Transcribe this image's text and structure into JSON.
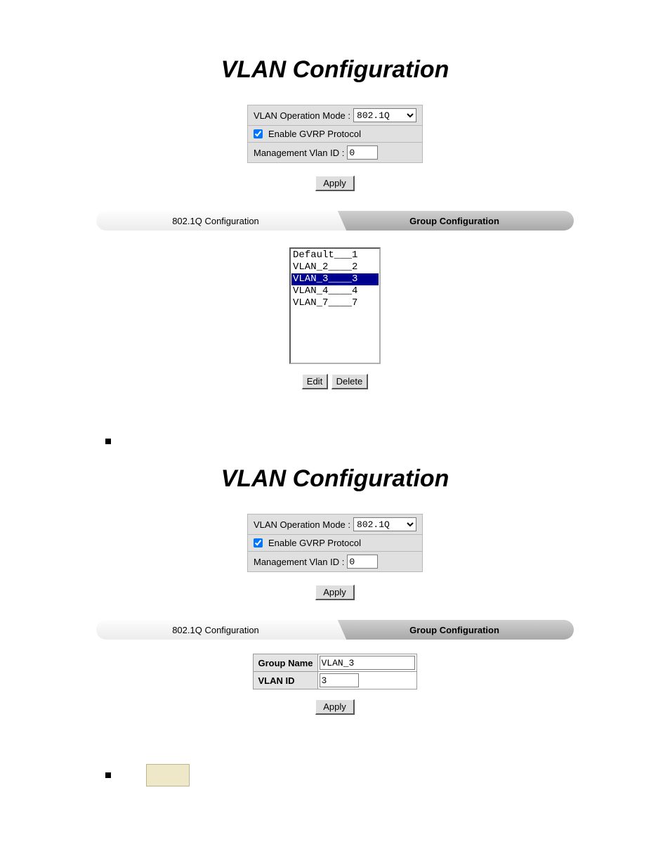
{
  "section1": {
    "title": "VLAN Configuration",
    "op_label": "VLAN Operation Mode : ",
    "op_value": "802.1Q",
    "gvrp_checked": true,
    "gvrp_label": " Enable GVRP Protocol",
    "mgmt_label": "Management Vlan ID : ",
    "mgmt_value": "0",
    "apply": "Apply",
    "tab_inactive": "802.1Q Configuration",
    "tab_active": "Group Configuration",
    "list": [
      {
        "text": "Default___1",
        "selected": false
      },
      {
        "text": "VLAN_2____2",
        "selected": false
      },
      {
        "text": "VLAN_3____3",
        "selected": true
      },
      {
        "text": "VLAN_4____4",
        "selected": false
      },
      {
        "text": "VLAN_7____7",
        "selected": false
      }
    ],
    "edit": "Edit",
    "delete": "Delete"
  },
  "section2": {
    "title": "VLAN Configuration",
    "op_label": "VLAN Operation Mode : ",
    "op_value": "802.1Q",
    "gvrp_checked": true,
    "gvrp_label": " Enable GVRP Protocol",
    "mgmt_label": "Management Vlan ID : ",
    "mgmt_value": "0",
    "apply": "Apply",
    "tab_inactive": "802.1Q Configuration",
    "tab_active": "Group Configuration",
    "grp_name_label": "Group Name",
    "grp_name_value": "VLAN_3",
    "vlan_id_label": "VLAN ID",
    "vlan_id_value": "3",
    "apply2": "Apply"
  }
}
